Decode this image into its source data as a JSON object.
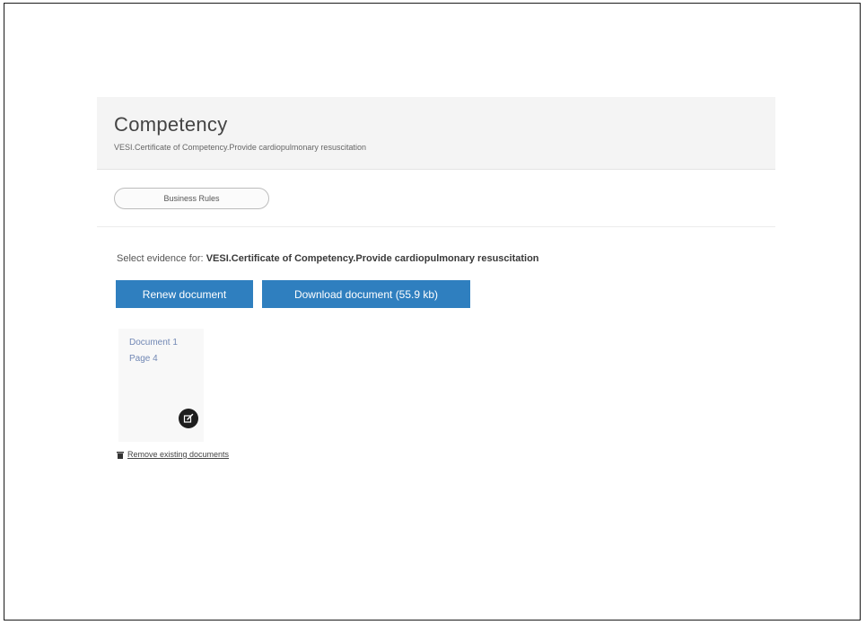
{
  "header": {
    "title": "Competency",
    "subtitle": "VESI.Certificate of Competency.Provide cardiopulmonary resuscitation"
  },
  "business_rules": {
    "label": "Business Rules"
  },
  "evidence": {
    "prompt": "Select evidence for:",
    "target": "VESI.Certificate of Competency.Provide cardiopulmonary resuscitation"
  },
  "actions": {
    "renew_label": "Renew document",
    "download_label": "Download document (55.9 kb)"
  },
  "document": {
    "name": "Document 1",
    "page": "Page 4",
    "edit_icon": "edit-icon"
  },
  "remove": {
    "icon": "trash-icon",
    "label": "Remove existing documents"
  },
  "colors": {
    "primary_button": "#2f7fbf",
    "link": "#7288b5",
    "header_bg": "#f4f4f4"
  }
}
